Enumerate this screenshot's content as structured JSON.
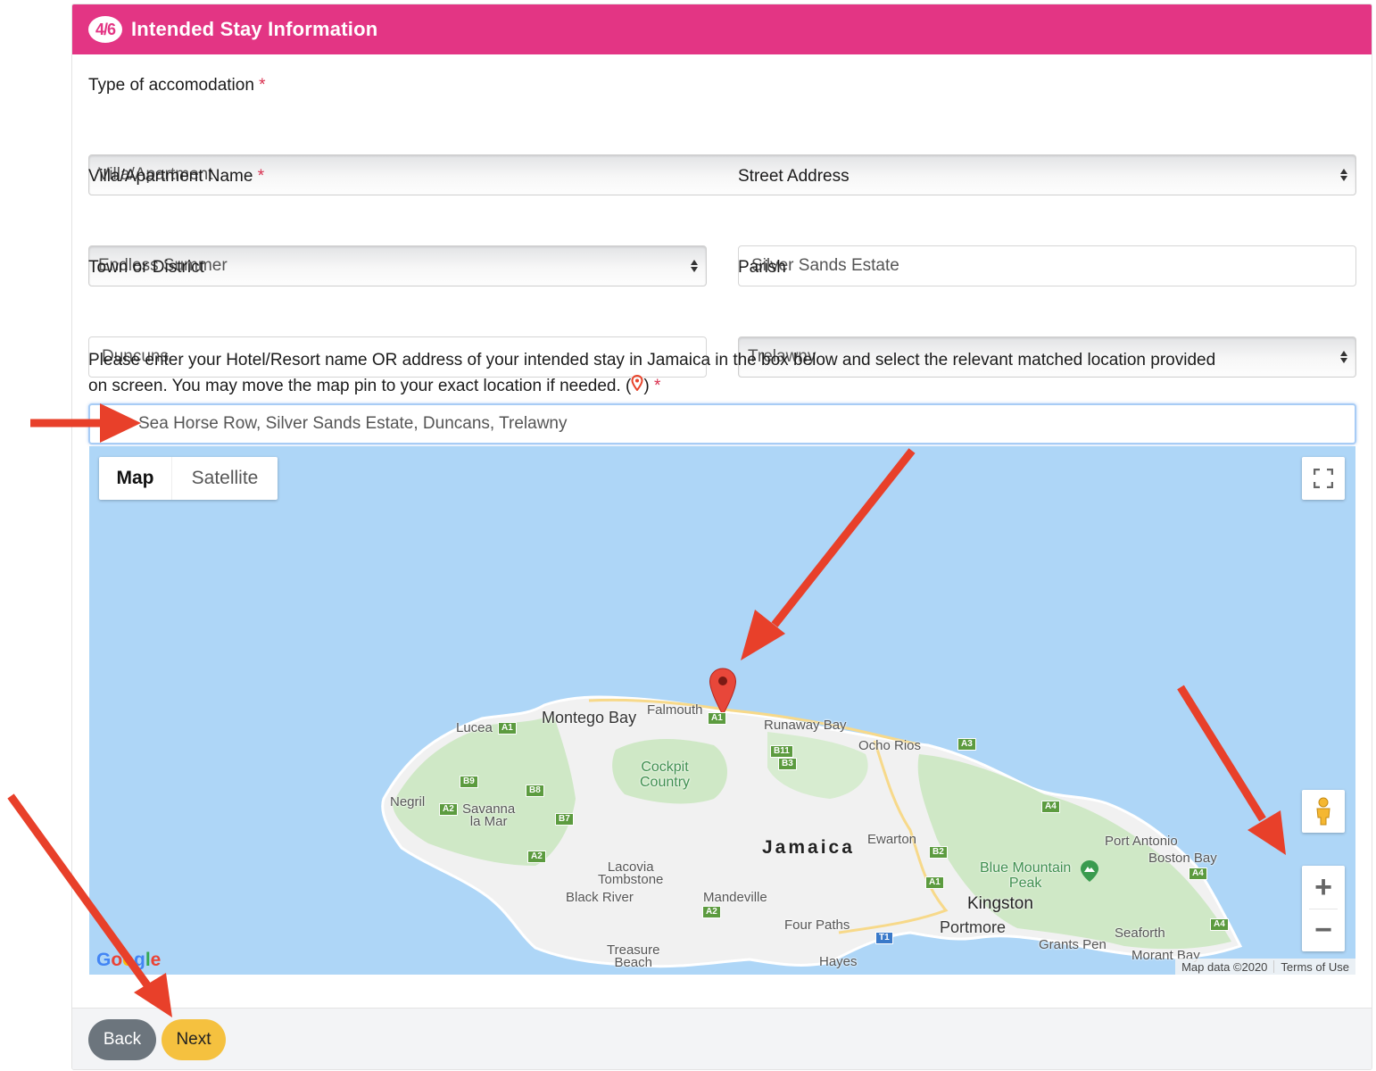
{
  "header": {
    "step_badge": "4/6",
    "title": "Intended Stay Information",
    "color": "#e33584"
  },
  "form": {
    "accommodation_type": {
      "label": "Type of accomodation",
      "required_mark": "*",
      "value": "Villa/Apartment"
    },
    "villa_name": {
      "label": "Villa/Apartment Name",
      "required_mark": "*",
      "value": "Endless Summer"
    },
    "street_address": {
      "label": "Street Address",
      "value": "Silver Sands Estate"
    },
    "town": {
      "label": "Town or District",
      "value": "Duncuns"
    },
    "parish": {
      "label": "Parish",
      "value": "Trelawny"
    },
    "instructions_line1": "Please enter your Hotel/Resort name OR address of your intended stay in Jamaica in the box below and select the relevant matched location provided",
    "instructions_line2": "on screen. You may move the map pin to your exact location if needed. (",
    "instructions_close": ")",
    "required_mark": "*",
    "location_search_value": "Sea Horse Row, Silver Sands Estate, Duncans, Trelawny"
  },
  "map": {
    "type_buttons": {
      "map": "Map",
      "satellite": "Satellite"
    },
    "zoom_in": "+",
    "zoom_out": "−",
    "google_logo": [
      "G",
      "o",
      "o",
      "g",
      "l",
      "e"
    ],
    "attribution": {
      "data": "Map data ©2020",
      "terms": "Terms of Use"
    },
    "country_label": "Jamaica",
    "places": {
      "montego_bay": "Montego Bay",
      "falmouth": "Falmouth",
      "lucea": "Lucea",
      "runaway_bay": "Runaway Bay",
      "ocho_rios": "Ocho Rios",
      "cockpit_country": "Cockpit\nCountry",
      "negril": "Negril",
      "savanna_la_mar": "Savanna\nla Mar",
      "ewarton": "Ewarton",
      "port_antonio": "Port Antonio",
      "boston_bay": "Boston Bay",
      "blue_mountain_peak": "Blue Mountain\nPeak",
      "kingston": "Kingston",
      "portmore": "Portmore",
      "lacovia_tombstone": "Lacovia\nTombstone",
      "black_river": "Black River",
      "mandeville": "Mandeville",
      "four_paths": "Four Paths",
      "treasure_beach": "Treasure\nBeach",
      "hayes": "Hayes",
      "grants_pen": "Grants Pen",
      "seaforth": "Seaforth",
      "morant_bay": "Morant Bay"
    },
    "road_shields": [
      "A1",
      "A1",
      "B11",
      "B3",
      "A3",
      "B9",
      "B8",
      "A2",
      "B7",
      "A4",
      "A2",
      "B2",
      "A1",
      "A2",
      "T1",
      "A4",
      "A4"
    ]
  },
  "footer": {
    "back": "Back",
    "next": "Next",
    "back_color": "#6c757d",
    "next_color": "#f5c13f"
  }
}
